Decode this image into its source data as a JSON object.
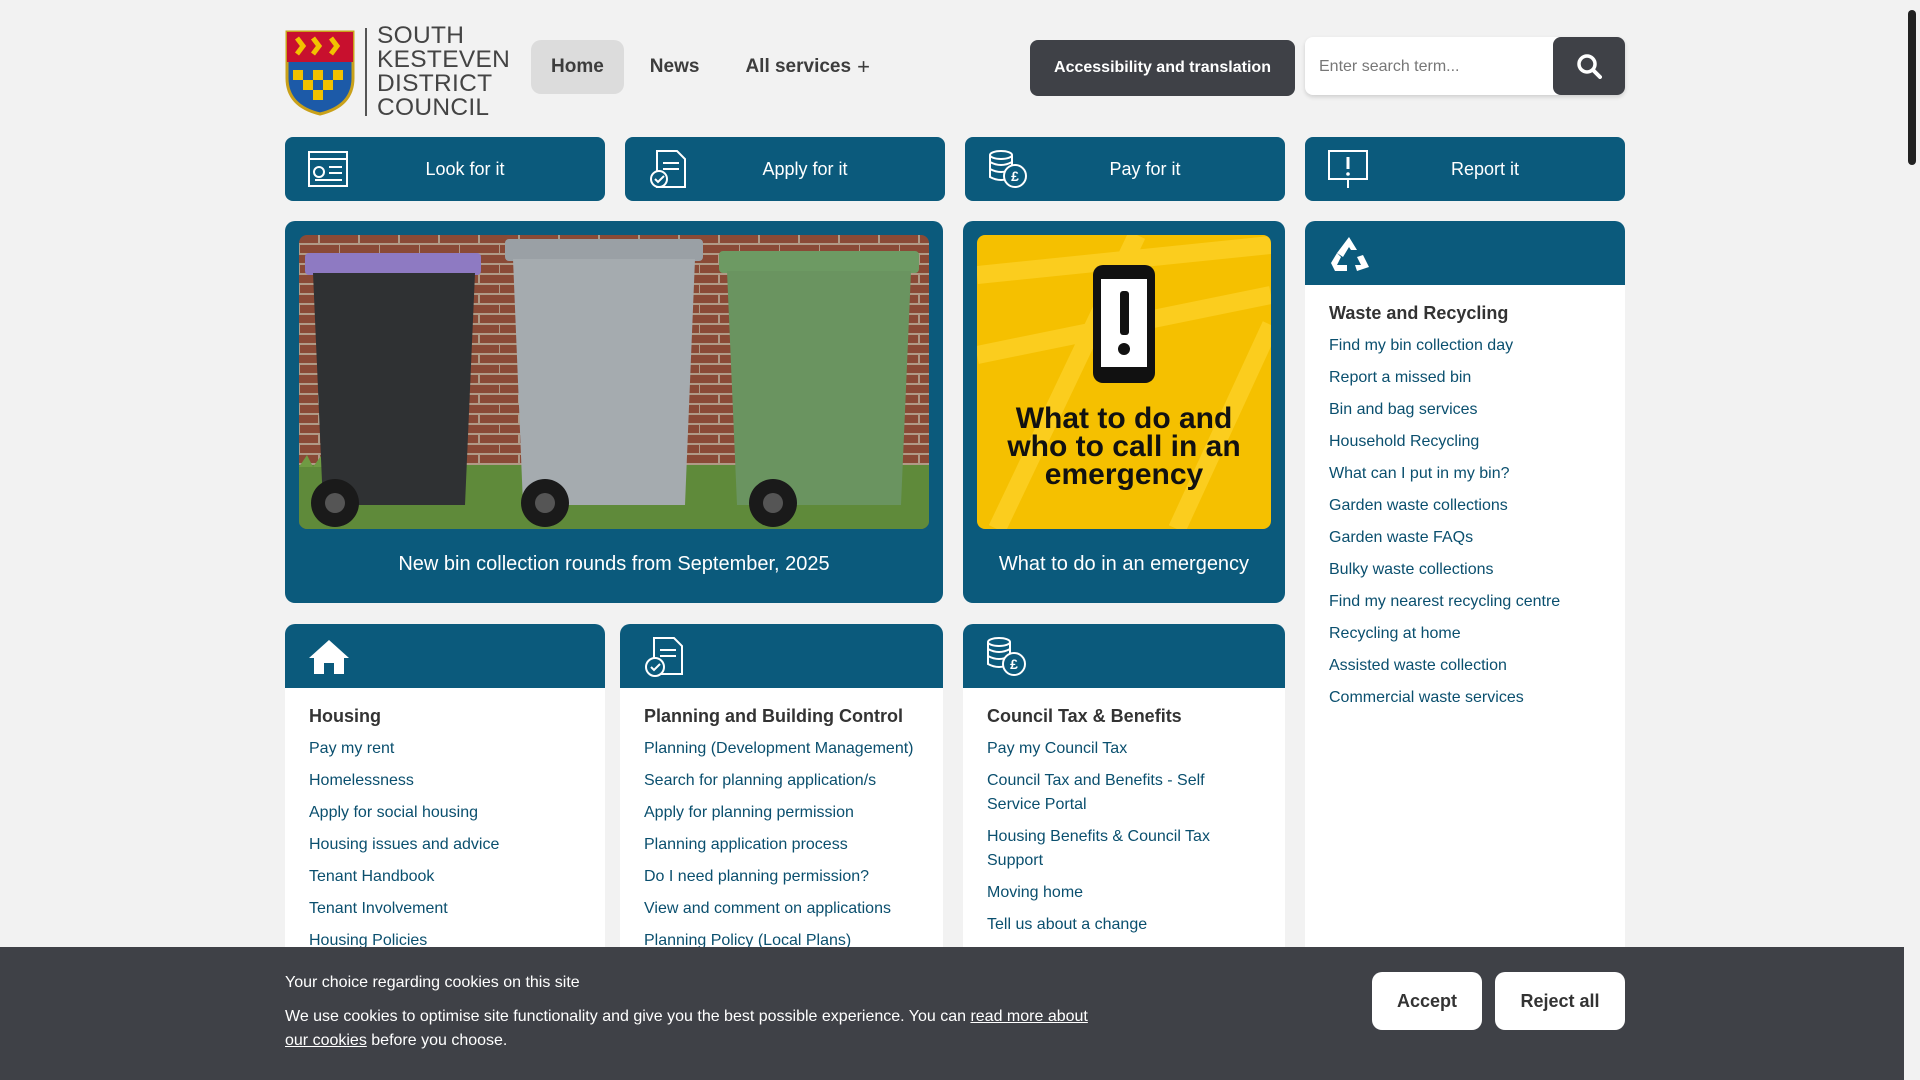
{
  "header": {
    "logo_lines": [
      "SOUTH",
      "KESTEVEN",
      "DISTRICT",
      "COUNCIL"
    ],
    "nav": [
      {
        "label": "Home",
        "active": true
      },
      {
        "label": "News",
        "active": false
      },
      {
        "label": "All services",
        "plus": "+"
      }
    ],
    "accessibility_label": "Accessibility and translation",
    "search_placeholder": "Enter search term..."
  },
  "quick_actions": [
    {
      "label": "Look for it",
      "icon": "search-listing-icon"
    },
    {
      "label": "Apply for it",
      "icon": "form-check-icon"
    },
    {
      "label": "Pay for it",
      "icon": "coins-pound-icon"
    },
    {
      "label": "Report it",
      "icon": "report-sign-icon"
    }
  ],
  "features": {
    "bins_caption": "New bin collection rounds from September, 2025",
    "emergency_caption": "What to do in an emergency",
    "emergency_poster_text": [
      "What to do and",
      "who to call in an",
      "emergency"
    ]
  },
  "cards": {
    "waste": {
      "title": "Waste and Recycling",
      "links": [
        "Find my bin collection day",
        "Report a missed bin",
        "Bin and bag services",
        "Household Recycling",
        "What can I put in my bin?",
        "Garden waste collections",
        "Garden waste FAQs",
        "Bulky waste collections",
        "Find my nearest recycling centre",
        "Recycling at home",
        "Assisted waste collection",
        "Commercial waste services"
      ]
    },
    "housing": {
      "title": "Housing",
      "links": [
        "Pay my rent",
        "Homelessness",
        "Apply for social housing",
        "Housing issues and advice",
        "Tenant Handbook",
        "Tenant Involvement",
        "Housing Policies"
      ]
    },
    "planning": {
      "title": "Planning and Building Control",
      "links": [
        "Planning (Development Management)",
        "Search for planning application/s",
        "Apply for planning permission",
        "Planning application process",
        "Do I need planning permission?",
        "View and comment on applications",
        "Planning Policy (Local Plans)"
      ]
    },
    "tax": {
      "title": "Council Tax & Benefits",
      "links": [
        "Pay my Council Tax",
        "Council Tax and Benefits - Self Service Portal",
        "Housing Benefits & Council Tax Support",
        "Moving home",
        "Tell us about a change"
      ]
    }
  },
  "cookie": {
    "title": "Your choice regarding cookies on this site",
    "text_before": "We use cookies to optimise site functionality and give you the best possible experience. You can ",
    "link": "read more about our cookies",
    "text_after": " before you choose.",
    "accept": "Accept",
    "reject": "Reject all"
  },
  "colors": {
    "brand": "#0b5a7c",
    "dark": "#3f4147",
    "link": "#0a4f6e",
    "poster_yellow": "#f5c000"
  }
}
